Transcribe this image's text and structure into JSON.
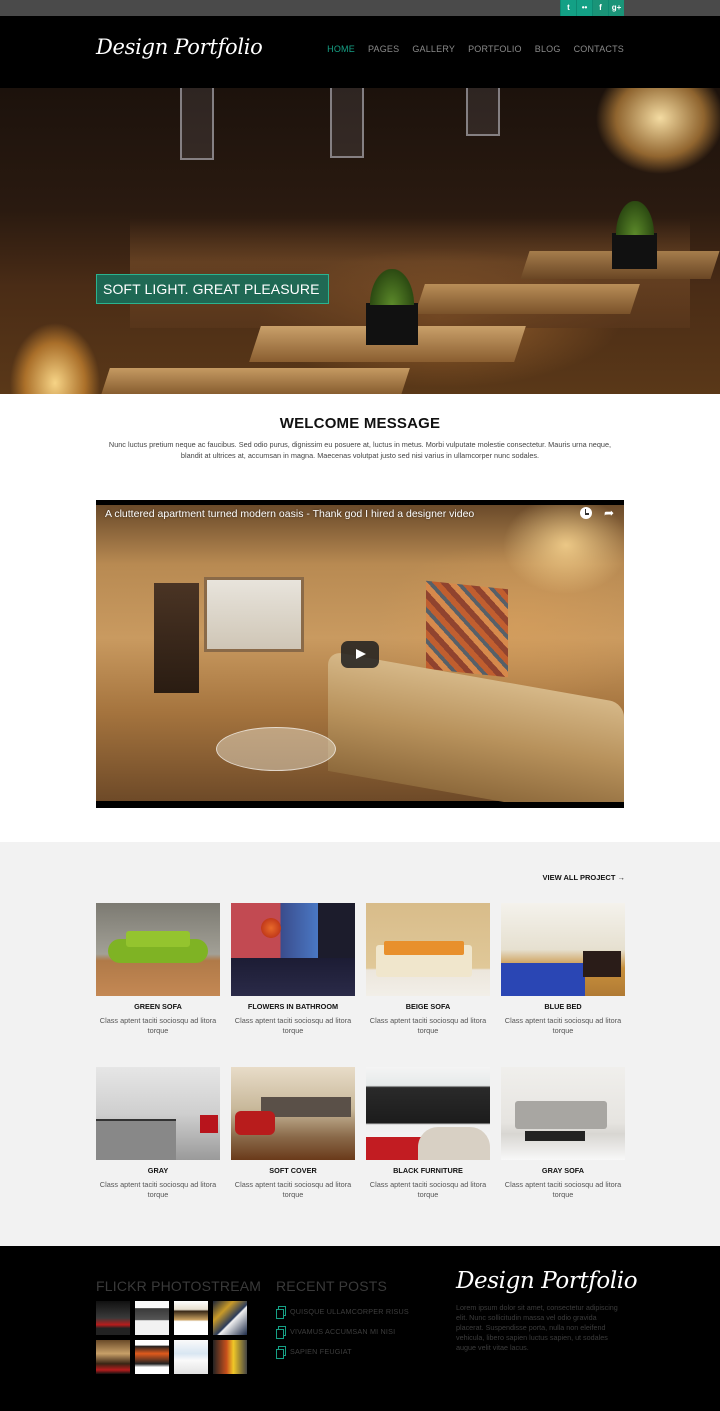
{
  "topbar": {
    "social": [
      {
        "name": "twitter",
        "glyph": "t"
      },
      {
        "name": "flickr",
        "glyph": "••"
      },
      {
        "name": "facebook",
        "glyph": "f"
      },
      {
        "name": "google-plus",
        "glyph": "g+"
      }
    ]
  },
  "header": {
    "logo": "Design Portfolio",
    "nav": [
      {
        "label": "HOME",
        "active": true
      },
      {
        "label": "PAGES"
      },
      {
        "label": "GALLERY"
      },
      {
        "label": "PORTFOLIO"
      },
      {
        "label": "BLOG"
      },
      {
        "label": "CONTACTS"
      }
    ],
    "accent_color": "#16a085"
  },
  "hero": {
    "caption": "SOFT LIGHT. GREAT PLEASURE",
    "slides": 2,
    "active_slide": 2
  },
  "welcome": {
    "title": "WELCOME MESSAGE",
    "text": "Nunc luctus pretium neque ac faucibus. Sed odio purus, dignissim eu posuere at, luctus in metus. Morbi vulputate molestie consectetur. Mauris urna neque, blandit at ultrices at, accumsan in magna. Maecenas volutpat justo sed nisi varius in ullamcorper nunc sodales."
  },
  "video": {
    "title": "A cluttered apartment turned modern oasis - Thank god I hired a designer video",
    "share_glyph": "➦"
  },
  "portfolio": {
    "view_all": "VIEW ALL PROJECT →",
    "items": [
      {
        "name": "GREEN SOFA",
        "desc": "Class aptent taciti sociosqu ad litora torque"
      },
      {
        "name": "FLOWERS IN BATHROOM",
        "desc": "Class aptent taciti sociosqu ad litora torque"
      },
      {
        "name": "BEIGE SOFA",
        "desc": "Class aptent taciti sociosqu ad litora torque"
      },
      {
        "name": "BLUE BED",
        "desc": "Class aptent taciti sociosqu ad litora torque"
      },
      {
        "name": "GRAY",
        "desc": "Class aptent taciti sociosqu ad litora torque"
      },
      {
        "name": "SOFT COVER",
        "desc": "Class aptent taciti sociosqu ad litora torque"
      },
      {
        "name": "BLACK FURNITURE",
        "desc": "Class aptent taciti sociosqu ad litora torque"
      },
      {
        "name": "GRAY SOFA",
        "desc": "Class aptent taciti sociosqu ad litora torque"
      }
    ]
  },
  "footer": {
    "flickr_heading": "FLICKR PHOTOSTREAM",
    "flickr_count": 8,
    "recent_heading": "RECENT POSTS",
    "recent_posts": [
      "QUISQUE ULLAMCORPER RISUS",
      "VIVAMUS ACCUMSAN MI NISI",
      "SAPIEN FEUGIAT"
    ],
    "logo": "Design Portfolio",
    "about": "Lorem ipsum dolor sit amet, consectetur adipiscing elit. Nunc sollicitudin massa vel odio gravida placerat. Suspendisse porta, nulla non eleifend vehicula, libero sapien luctus sapien, ut sodales augue velit vitae lacus."
  }
}
